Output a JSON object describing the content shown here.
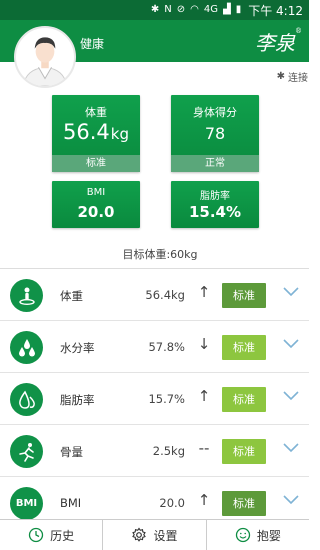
{
  "status_bar": {
    "time_label": "下午 4:12",
    "network": "4G"
  },
  "header": {
    "username": "健康",
    "logo_text": "李泉",
    "logo_mark": "®",
    "connect_label": "连接"
  },
  "cards": {
    "weight": {
      "label": "体重",
      "value": "56.4",
      "unit": "kg",
      "status": "标准"
    },
    "score": {
      "label": "身体得分",
      "value": "78",
      "status": "正常"
    },
    "bmi": {
      "label": "BMI",
      "value": "20.0"
    },
    "fat": {
      "label": "脂肪率",
      "value": "15.4%"
    }
  },
  "target_weight": "目标体重:60kg",
  "metrics": [
    {
      "icon": "person-scale-icon",
      "name": "体重",
      "value": "56.4kg",
      "trend": "↑",
      "status": "标准",
      "status_style": "dark"
    },
    {
      "icon": "water-drops-icon",
      "name": "水分率",
      "value": "57.8%",
      "trend": "↓",
      "status": "标准",
      "status_style": "light"
    },
    {
      "icon": "fat-drop-icon",
      "name": "脂肪率",
      "value": "15.7%",
      "trend": "↑",
      "status": "标准",
      "status_style": "light"
    },
    {
      "icon": "bone-runner-icon",
      "name": "骨量",
      "value": "2.5kg",
      "trend": "--",
      "status": "标准",
      "status_style": "light"
    },
    {
      "icon": "bmi-icon",
      "icon_text": "BMI",
      "name": "BMI",
      "value": "20.0",
      "trend": "↑",
      "status": "标准",
      "status_style": "dark"
    }
  ],
  "bottom_nav": {
    "history_label": "历史",
    "settings_label": "设置",
    "baby_label": "抱婴"
  },
  "colors": {
    "primary": "#0e8d43",
    "status_bar": "#0c6b35",
    "badge_dark": "#5d9a3a",
    "badge_light": "#8dc63f",
    "chevron": "#7fb3d5"
  }
}
